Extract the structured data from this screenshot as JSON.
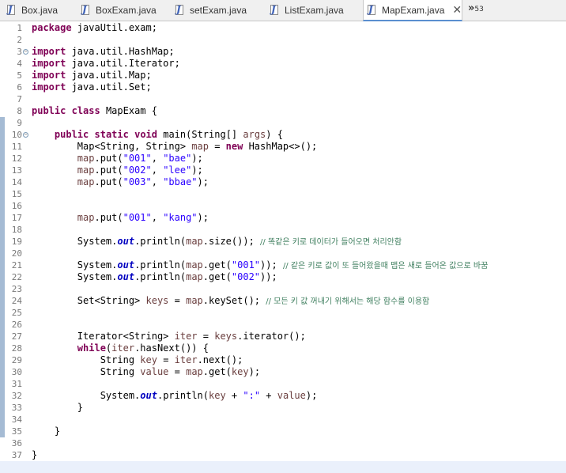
{
  "tabs": [
    {
      "label": "Box.java",
      "active": false
    },
    {
      "label": "BoxExam.java",
      "active": false
    },
    {
      "label": "setExam.java",
      "active": false
    },
    {
      "label": "ListExam.java",
      "active": false
    },
    {
      "label": "MapExam.java",
      "active": true
    }
  ],
  "overflow": {
    "symbol": "»",
    "count": "53"
  },
  "editor": {
    "line_numbers": [
      "1",
      "2",
      "3",
      "4",
      "5",
      "6",
      "7",
      "8",
      "9",
      "10",
      "11",
      "12",
      "13",
      "14",
      "15",
      "16",
      "17",
      "18",
      "19",
      "20",
      "21",
      "22",
      "23",
      "24",
      "25",
      "26",
      "27",
      "28",
      "29",
      "30",
      "31",
      "32",
      "33",
      "34",
      "35",
      "36",
      "37"
    ],
    "lines": [
      [
        {
          "t": "package",
          "c": "kw"
        },
        {
          "t": " javaUtil.exam;"
        }
      ],
      [],
      [
        {
          "t": "import",
          "c": "kw"
        },
        {
          "t": " java.util.HashMap;"
        }
      ],
      [
        {
          "t": "import",
          "c": "kw"
        },
        {
          "t": " java.util.Iterator;"
        }
      ],
      [
        {
          "t": "import",
          "c": "kw"
        },
        {
          "t": " java.util.Map;"
        }
      ],
      [
        {
          "t": "import",
          "c": "kw"
        },
        {
          "t": " java.util.Set;"
        }
      ],
      [],
      [
        {
          "t": "public",
          "c": "kw"
        },
        {
          "t": " "
        },
        {
          "t": "class",
          "c": "kw"
        },
        {
          "t": " MapExam {"
        }
      ],
      [],
      [
        {
          "t": "    "
        },
        {
          "t": "public",
          "c": "kw"
        },
        {
          "t": " "
        },
        {
          "t": "static",
          "c": "kw"
        },
        {
          "t": " "
        },
        {
          "t": "void",
          "c": "kw"
        },
        {
          "t": " main(String[] "
        },
        {
          "t": "args",
          "c": "loc"
        },
        {
          "t": ") {"
        }
      ],
      [
        {
          "t": "        Map<String, String> "
        },
        {
          "t": "map",
          "c": "loc"
        },
        {
          "t": " = "
        },
        {
          "t": "new",
          "c": "kw"
        },
        {
          "t": " HashMap<>();"
        }
      ],
      [
        {
          "t": "        "
        },
        {
          "t": "map",
          "c": "loc"
        },
        {
          "t": ".put("
        },
        {
          "t": "\"001\"",
          "c": "str"
        },
        {
          "t": ", "
        },
        {
          "t": "\"bae\"",
          "c": "str"
        },
        {
          "t": ");"
        }
      ],
      [
        {
          "t": "        "
        },
        {
          "t": "map",
          "c": "loc"
        },
        {
          "t": ".put("
        },
        {
          "t": "\"002\"",
          "c": "str"
        },
        {
          "t": ", "
        },
        {
          "t": "\"lee\"",
          "c": "str"
        },
        {
          "t": ");"
        }
      ],
      [
        {
          "t": "        "
        },
        {
          "t": "map",
          "c": "loc"
        },
        {
          "t": ".put("
        },
        {
          "t": "\"003\"",
          "c": "str"
        },
        {
          "t": ", "
        },
        {
          "t": "\"bbae\"",
          "c": "str"
        },
        {
          "t": ");"
        }
      ],
      [],
      [],
      [
        {
          "t": "        "
        },
        {
          "t": "map",
          "c": "loc"
        },
        {
          "t": ".put("
        },
        {
          "t": "\"001\"",
          "c": "str"
        },
        {
          "t": ", "
        },
        {
          "t": "\"kang\"",
          "c": "str"
        },
        {
          "t": ");"
        }
      ],
      [],
      [
        {
          "t": "        System."
        },
        {
          "t": "out",
          "c": "st"
        },
        {
          "t": ".println("
        },
        {
          "t": "map",
          "c": "loc"
        },
        {
          "t": ".size()); "
        },
        {
          "t": "// 똑같은 키로 데이터가 들어오면 처리안함",
          "c": "cmt"
        }
      ],
      [],
      [
        {
          "t": "        System."
        },
        {
          "t": "out",
          "c": "st"
        },
        {
          "t": ".println("
        },
        {
          "t": "map",
          "c": "loc"
        },
        {
          "t": ".get("
        },
        {
          "t": "\"001\"",
          "c": "str"
        },
        {
          "t": ")); "
        },
        {
          "t": "// 같은 키로 값이 또 들어왔을때 맵은 새로 들어온 값으로 바꿈",
          "c": "cmt"
        }
      ],
      [
        {
          "t": "        System."
        },
        {
          "t": "out",
          "c": "st"
        },
        {
          "t": ".println("
        },
        {
          "t": "map",
          "c": "loc"
        },
        {
          "t": ".get("
        },
        {
          "t": "\"002\"",
          "c": "str"
        },
        {
          "t": "));"
        }
      ],
      [],
      [
        {
          "t": "        Set<String> "
        },
        {
          "t": "keys",
          "c": "loc"
        },
        {
          "t": " = "
        },
        {
          "t": "map",
          "c": "loc"
        },
        {
          "t": ".keySet(); "
        },
        {
          "t": "// 모든 키 값 꺼내기 위해서는 해당 함수를 이용함",
          "c": "cmt"
        }
      ],
      [],
      [],
      [
        {
          "t": "        Iterator<String> "
        },
        {
          "t": "iter",
          "c": "loc"
        },
        {
          "t": " = "
        },
        {
          "t": "keys",
          "c": "loc"
        },
        {
          "t": ".iterator();"
        }
      ],
      [
        {
          "t": "        "
        },
        {
          "t": "while",
          "c": "kw"
        },
        {
          "t": "("
        },
        {
          "t": "iter",
          "c": "loc"
        },
        {
          "t": ".hasNext()) {"
        }
      ],
      [
        {
          "t": "            String "
        },
        {
          "t": "key",
          "c": "loc"
        },
        {
          "t": " = "
        },
        {
          "t": "iter",
          "c": "loc"
        },
        {
          "t": ".next();"
        }
      ],
      [
        {
          "t": "            String "
        },
        {
          "t": "value",
          "c": "loc"
        },
        {
          "t": " = "
        },
        {
          "t": "map",
          "c": "loc"
        },
        {
          "t": ".get("
        },
        {
          "t": "key",
          "c": "loc"
        },
        {
          "t": ");"
        }
      ],
      [],
      [
        {
          "t": "            System."
        },
        {
          "t": "out",
          "c": "st"
        },
        {
          "t": ".println("
        },
        {
          "t": "key",
          "c": "loc"
        },
        {
          "t": " + "
        },
        {
          "t": "\":\"",
          "c": "str"
        },
        {
          "t": " + "
        },
        {
          "t": "value",
          "c": "loc"
        },
        {
          "t": ");"
        }
      ],
      [
        {
          "t": "        }"
        }
      ],
      [],
      [
        {
          "t": "    }"
        }
      ],
      [],
      [
        {
          "t": "}"
        }
      ]
    ]
  },
  "colors": {
    "keyword": "#7f0055",
    "string": "#2a00ff",
    "comment": "#3f7f5f",
    "static_field": "#0000c0",
    "local_var": "#6a3e3e",
    "change_bar": "#a5bbd4"
  }
}
